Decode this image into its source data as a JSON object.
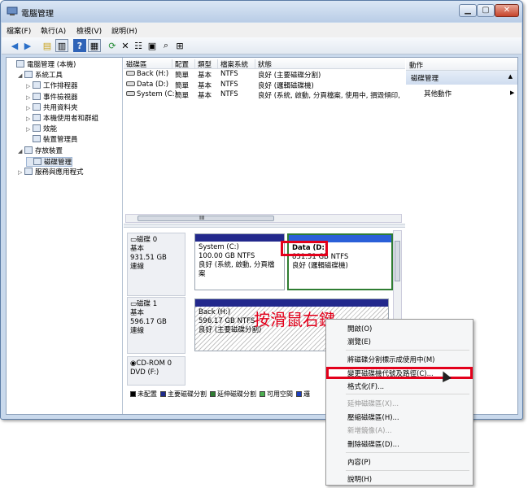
{
  "window": {
    "title": "電腦管理"
  },
  "menu": [
    "檔案(F)",
    "執行(A)",
    "檢視(V)",
    "說明(H)"
  ],
  "toolbar_icons": [
    "back-arrow-icon",
    "forward-arrow-icon",
    "up-folder-icon",
    "show-tree-icon",
    "help-icon",
    "console-icon",
    "refresh-icon",
    "delete-icon",
    "properties-icon",
    "open-icon",
    "search-icon",
    "export-icon"
  ],
  "tree": [
    {
      "label": "電腦管理 (本機)",
      "level": 0,
      "exp": ""
    },
    {
      "label": "系統工具",
      "level": 1,
      "exp": "◢"
    },
    {
      "label": "工作排程器",
      "level": 2,
      "exp": "▷"
    },
    {
      "label": "事件檢視器",
      "level": 2,
      "exp": "▷"
    },
    {
      "label": "共用資料夾",
      "level": 2,
      "exp": "▷"
    },
    {
      "label": "本機使用者和群組",
      "level": 2,
      "exp": "▷"
    },
    {
      "label": "效能",
      "level": 2,
      "exp": "▷"
    },
    {
      "label": "裝置管理員",
      "level": 2,
      "exp": ""
    },
    {
      "label": "存放裝置",
      "level": 1,
      "exp": "◢"
    },
    {
      "label": "磁碟管理",
      "level": 2,
      "exp": ""
    },
    {
      "label": "服務與應用程式",
      "level": 1,
      "exp": "▷"
    }
  ],
  "volume_headers": [
    "磁碟區",
    "配置",
    "類型",
    "檔案系統",
    "狀態"
  ],
  "volumes": [
    {
      "name": "Back (H:)",
      "layout": "簡單",
      "type": "基本",
      "fs": "NTFS",
      "status": "良好 (主要磁碟分割)"
    },
    {
      "name": "Data (D:)",
      "layout": "簡單",
      "type": "基本",
      "fs": "NTFS",
      "status": "良好 (邏輯磁碟機)"
    },
    {
      "name": "System (C:)",
      "layout": "簡單",
      "type": "基本",
      "fs": "NTFS",
      "status": "良好 (系統, 啟動, 分頁檔案, 使用中, 損毀傾印,"
    }
  ],
  "scroll_label": "III",
  "disks": [
    {
      "name": "磁碟 0",
      "type": "基本",
      "size": "931.51 GB",
      "state": "連線"
    },
    {
      "name": "磁碟 1",
      "type": "基本",
      "size": "596.17 GB",
      "state": "連線"
    },
    {
      "name": "CD-ROM 0",
      "type": "DVD (F:)",
      "size": "",
      "state": ""
    }
  ],
  "partitions": {
    "system": {
      "name": "System (C:)",
      "size": "100.00 GB NTFS",
      "status": "良好 (系統, 啟動, 分頁檔案"
    },
    "data": {
      "name": "Data (D:)",
      "size": "831.51 GB NTFS",
      "status": "良好 (邏輯磁碟機)"
    },
    "back": {
      "name": "Back (H:)",
      "size": "596.17 GB NTFS",
      "status": "良好 (主要磁碟分割)"
    }
  },
  "legend": [
    {
      "label": "未配置",
      "color": "#000000"
    },
    {
      "label": "主要磁碟分割",
      "color": "#1e2b8c"
    },
    {
      "label": "延伸磁碟分割",
      "color": "#2e7d32"
    },
    {
      "label": "可用空間",
      "color": "#4caf50"
    },
    {
      "label": "邏",
      "color": "#1e3fbf"
    }
  ],
  "actions": {
    "header": "動作",
    "section": "磁碟管理",
    "more": "其他動作"
  },
  "context_menu": [
    {
      "label": "開啟(O)",
      "disabled": false
    },
    {
      "label": "瀏覽(E)",
      "disabled": false
    },
    {
      "label": "將磁碟分割標示成使用中(M)",
      "disabled": false
    },
    {
      "label": "變更磁碟機代號及路徑(C)...",
      "disabled": false
    },
    {
      "label": "格式化(F)...",
      "disabled": false
    },
    {
      "label": "延伸磁碟區(X)...",
      "disabled": true
    },
    {
      "label": "壓縮磁碟區(H)...",
      "disabled": false
    },
    {
      "label": "新增鏡像(A)...",
      "disabled": true
    },
    {
      "label": "刪除磁碟區(D)...",
      "disabled": false
    },
    {
      "label": "內容(P)",
      "disabled": false
    },
    {
      "label": "說明(H)",
      "disabled": false
    }
  ],
  "annotation": "按滑鼠右鍵",
  "colors": {
    "highlight": "#e3001b",
    "primary_bar": "#22288c",
    "selection": "#2f7d32"
  }
}
